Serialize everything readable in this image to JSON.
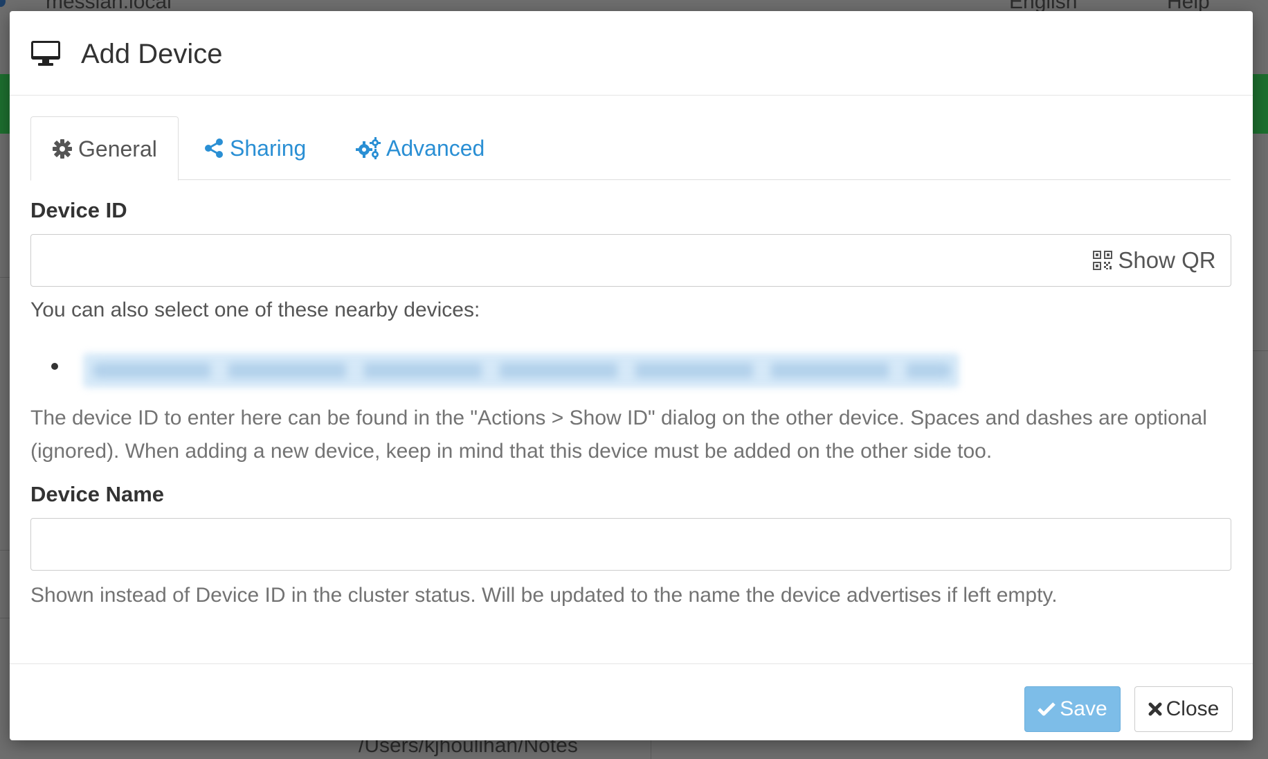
{
  "background": {
    "host": "messiah.local",
    "language": "English",
    "help": "Help",
    "folder_path": "/Users/kjhoulihan/Notes"
  },
  "modal": {
    "title": "Add Device",
    "tabs": [
      {
        "label": "General",
        "icon": "gear-icon",
        "active": true
      },
      {
        "label": "Sharing",
        "icon": "share-icon",
        "active": false
      },
      {
        "label": "Advanced",
        "icon": "gears-icon",
        "active": false
      }
    ],
    "device_id": {
      "label": "Device ID",
      "value": "",
      "qr_button_label": "Show QR",
      "nearby_intro": "You can also select one of these nearby devices:",
      "help": "The device ID to enter here can be found in the \"Actions > Show ID\" dialog on the other device. Spaces and dashes are optional (ignored). When adding a new device, keep in mind that this device must be added on the other side too."
    },
    "device_name": {
      "label": "Device Name",
      "value": "",
      "help": "Shown instead of Device ID in the cluster status. Will be updated to the name the device advertises if left empty."
    },
    "footer": {
      "save_label": "Save",
      "close_label": "Close"
    }
  },
  "colors": {
    "link": "#2a8fd4",
    "save_button": "#7dbde8",
    "backdrop": "#6e6e6e"
  }
}
